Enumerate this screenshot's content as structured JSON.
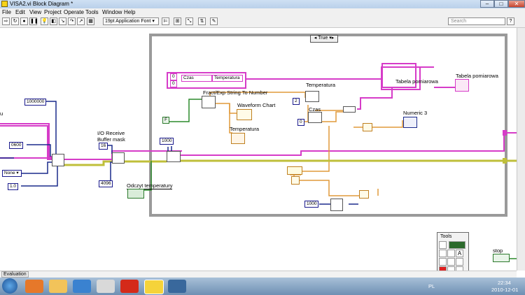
{
  "window": {
    "title": "VISA2.vi Block Diagram *"
  },
  "menu": [
    "File",
    "Edit",
    "View",
    "Project",
    "Operate",
    "Tools",
    "Window",
    "Help"
  ],
  "toolbar": {
    "font": "19pt Application Font",
    "search_placeholder": "Search"
  },
  "diagram": {
    "case_selector": "True",
    "constants": {
      "c1000000": "1000000",
      "c0600": "0600",
      "none": "None",
      "c1_0": "1.0",
      "c16": "16",
      "c4096": "4096",
      "c1000a": "1000",
      "c1000b": "1000",
      "c2": "2",
      "c0": "0",
      "false": "F",
      "c0a": "0",
      "c0b": "0"
    },
    "labels": {
      "left_cut": "u",
      "io_receive": "I/O Receive",
      "buffer_mask": "Buffer mask",
      "odczyt": "Odczyt temperatury",
      "fract": "Fract/Exp String To Number",
      "waveform": "Waveform Chart",
      "temp_ind": "Temperatura",
      "temperatura_bundle": "Temperatura",
      "czas_bundle": "Czas",
      "tabela_node": "Tabela pomiarowa",
      "tabela_ind": "Tabela pomiarowa",
      "numeric3": "Numeric 3",
      "stop": "stop",
      "str_czas": "Czas",
      "str_temp": "Temperatura"
    }
  },
  "tools_palette": {
    "title": "Tools"
  },
  "status": {
    "evaluation": "Evaluation"
  },
  "tray": {
    "lang": "PL",
    "time": "22:34",
    "date": "2010-12-01"
  },
  "colors": {
    "string_wire": "#d63cc8",
    "numeric_wire": "#e09a3a",
    "error_wire": "#bfbf3a",
    "blue_wire": "#1a2a8c",
    "bool_wire": "#2c8a2c"
  }
}
